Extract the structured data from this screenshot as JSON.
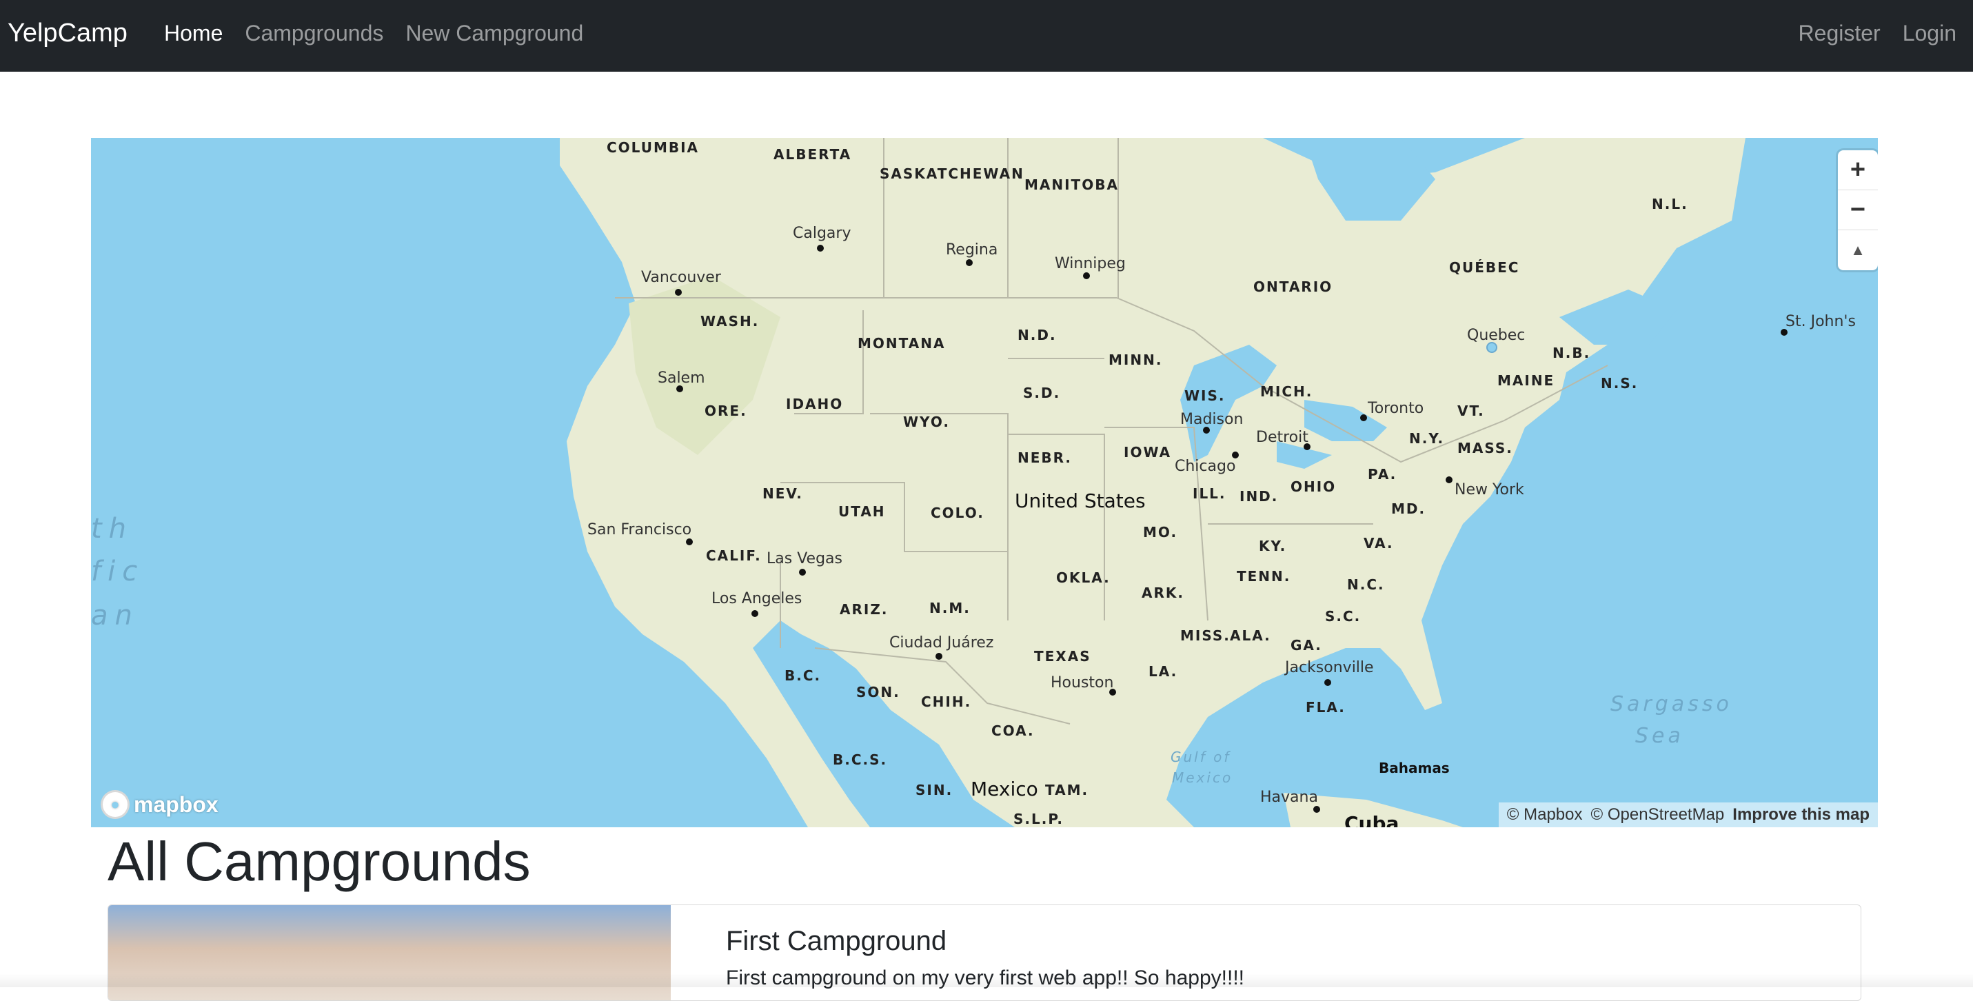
{
  "navbar": {
    "brand": "YelpCamp",
    "links": [
      {
        "label": "Home",
        "active": true
      },
      {
        "label": "Campgrounds"
      },
      {
        "label": "New Campground"
      }
    ],
    "right_links": [
      {
        "label": "Register"
      },
      {
        "label": "Login"
      }
    ]
  },
  "map": {
    "controls": {
      "zoom_in": "+",
      "zoom_out": "−",
      "compass": "▲"
    },
    "logo_text": "mapbox",
    "attribution": {
      "mapbox": "© Mapbox",
      "osm": "© OpenStreetMap",
      "improve": "Improve this map"
    },
    "country_labels": [
      "United States",
      "Mexico",
      "Cuba",
      "Bahamas"
    ],
    "region_labels": [
      "COLUMBIA",
      "ALBERTA",
      "SASKATCHEWAN",
      "MANITOBA",
      "ONTARIO",
      "QUÉBEC",
      "N.L.",
      "N.B.",
      "N.S.",
      "MAINE",
      "VT.",
      "MASS.",
      "N.Y.",
      "PA.",
      "MD.",
      "VA.",
      "N.C.",
      "S.C.",
      "GA.",
      "FLA.",
      "ALA.",
      "MISS.",
      "LA.",
      "TENN.",
      "KY.",
      "OHIO",
      "IND.",
      "ILL.",
      "MICH.",
      "WIS.",
      "MINN.",
      "IOWA",
      "MO.",
      "ARK.",
      "OKLA.",
      "TEXAS",
      "N.M.",
      "ARIZ.",
      "COLO.",
      "UTAH",
      "NEV.",
      "CALIF.",
      "ORE.",
      "IDAHO",
      "WASH.",
      "MONTANA",
      "WYO.",
      "N.D.",
      "S.D.",
      "NEBR.",
      "B.C.",
      "SON.",
      "CHIH.",
      "COA.",
      "B.C.S.",
      "SIN.",
      "TAM.",
      "S.L.P."
    ],
    "city_labels": [
      "Calgary",
      "Regina",
      "Winnipeg",
      "Vancouver",
      "Salem",
      "San Francisco",
      "Las Vegas",
      "Los Angeles",
      "Ciudad Juárez",
      "Houston",
      "Chicago",
      "Madison",
      "Detroit",
      "Toronto",
      "Quebec",
      "St. John's",
      "New York",
      "Jacksonville",
      "Havana"
    ],
    "water_labels": [
      "Gulf of",
      "Mexico",
      "Sargasso",
      "Sea",
      "th",
      "fic",
      "an"
    ]
  },
  "page_title": "All Campgrounds",
  "campground": {
    "title": "First Campground",
    "description": "First campground on my very first web app!! So happy!!!!"
  }
}
